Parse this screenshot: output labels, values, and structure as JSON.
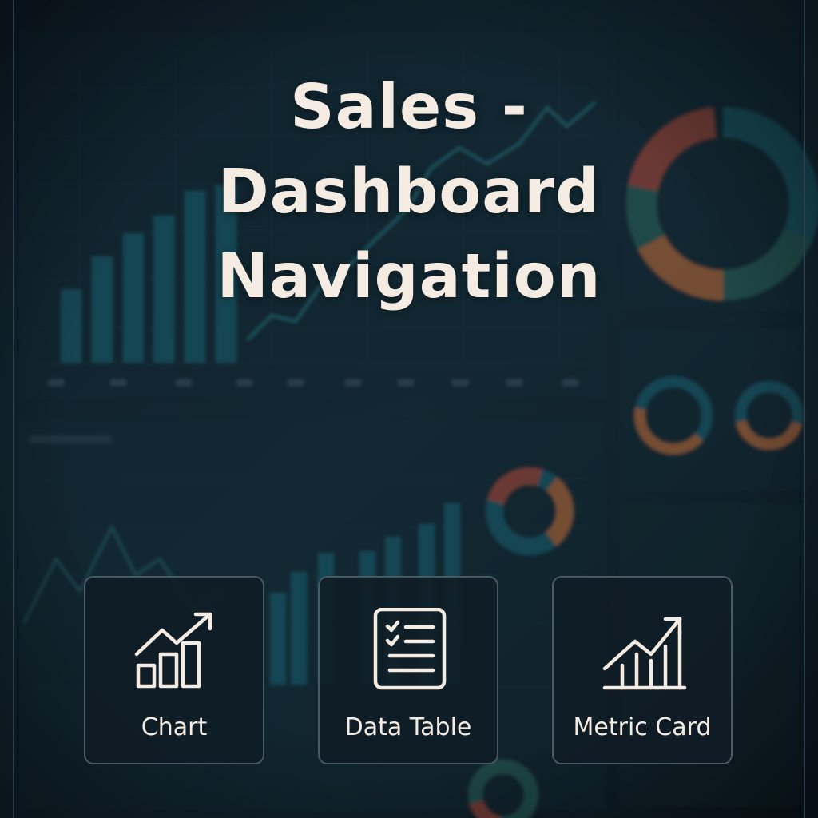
{
  "title": {
    "lines": [
      "Sales -",
      "Dashboard",
      "Navigation"
    ]
  },
  "colors": {
    "background": "#0f1d27",
    "title_text": "#f4ece2",
    "card_border": "#4a5a64",
    "card_fill": "#101c25",
    "chart_teal": "#1f6a78",
    "chart_orange": "#c87540",
    "chart_red": "#b6513f",
    "chart_green": "#2d6d63"
  },
  "nav": {
    "cards": [
      {
        "label": "Chart",
        "icon": "bar-chart-trend-icon"
      },
      {
        "label": "Data Table",
        "icon": "checklist-document-icon"
      },
      {
        "label": "Metric Card",
        "icon": "bar-trend-arrow-icon"
      }
    ]
  }
}
